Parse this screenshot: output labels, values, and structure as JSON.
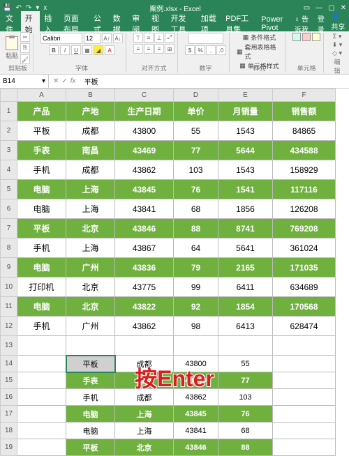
{
  "app": {
    "title": "案例.xlsx - Excel",
    "filename_tab": "x"
  },
  "menu": {
    "tabs": [
      "文件",
      "开始",
      "插入",
      "页面布局",
      "公式",
      "数据",
      "审阅",
      "视图",
      "开发工具",
      "加载项",
      "PDF工具集",
      "Power Pivot"
    ],
    "active": 1,
    "right": [
      "告诉我",
      "登录",
      "共享"
    ]
  },
  "ribbon": {
    "paste": "粘贴",
    "clipboard": "剪贴板",
    "font_name": "Calibri",
    "font_size": "12",
    "font_group": "字体",
    "align_group": "对齐方式",
    "number_group": "数字",
    "cond1": "条件格式",
    "cond2": "套用表格格式",
    "cond3": "单元格样式",
    "styles_group": "样式",
    "cells_group": "单元格",
    "edit_group": "编辑"
  },
  "namebox": "B14",
  "formula": "平板",
  "cols": [
    "A",
    "B",
    "C",
    "D",
    "E",
    "F"
  ],
  "headers": [
    "产品",
    "产地",
    "生产日期",
    "单价",
    "月销量",
    "销售额"
  ],
  "rows": [
    {
      "n": 2,
      "hl": false,
      "c": [
        "平板",
        "成都",
        "43800",
        "55",
        "1543",
        "84865"
      ]
    },
    {
      "n": 3,
      "hl": true,
      "c": [
        "手表",
        "南昌",
        "43469",
        "77",
        "5644",
        "434588"
      ]
    },
    {
      "n": 4,
      "hl": false,
      "c": [
        "手机",
        "成都",
        "43862",
        "103",
        "1543",
        "158929"
      ]
    },
    {
      "n": 5,
      "hl": true,
      "c": [
        "电脑",
        "上海",
        "43845",
        "76",
        "1541",
        "117116"
      ]
    },
    {
      "n": 6,
      "hl": false,
      "c": [
        "电脑",
        "上海",
        "43841",
        "68",
        "1856",
        "126208"
      ]
    },
    {
      "n": 7,
      "hl": true,
      "c": [
        "平板",
        "北京",
        "43846",
        "88",
        "8741",
        "769208"
      ]
    },
    {
      "n": 8,
      "hl": false,
      "c": [
        "手机",
        "上海",
        "43867",
        "64",
        "5641",
        "361024"
      ]
    },
    {
      "n": 9,
      "hl": true,
      "c": [
        "电脑",
        "广州",
        "43836",
        "79",
        "2165",
        "171035"
      ]
    },
    {
      "n": 10,
      "hl": false,
      "c": [
        "打印机",
        "北京",
        "43775",
        "99",
        "6411",
        "634689"
      ]
    },
    {
      "n": 11,
      "hl": true,
      "c": [
        "电脑",
        "北京",
        "43822",
        "92",
        "1854",
        "170568"
      ]
    },
    {
      "n": 12,
      "hl": false,
      "c": [
        "手机",
        "广州",
        "43862",
        "98",
        "6413",
        "628474"
      ]
    }
  ],
  "mini_rows": [
    {
      "n": 14,
      "hl": false,
      "active": true,
      "c": [
        "平板",
        "成都",
        "43800",
        "55"
      ]
    },
    {
      "n": 15,
      "hl": true,
      "c": [
        "手表",
        "南昌",
        "43469",
        "77"
      ]
    },
    {
      "n": 16,
      "hl": false,
      "c": [
        "手机",
        "成都",
        "43862",
        "103"
      ]
    },
    {
      "n": 17,
      "hl": true,
      "c": [
        "电脑",
        "上海",
        "43845",
        "76"
      ]
    },
    {
      "n": 18,
      "hl": false,
      "c": [
        "电脑",
        "上海",
        "43841",
        "68"
      ]
    },
    {
      "n": 19,
      "hl": true,
      "c": [
        "平板",
        "北京",
        "43846",
        "88"
      ]
    }
  ],
  "overlay_text": "按Enter",
  "colors": {
    "accent": "#2b8457",
    "highlight": "#6fb03f",
    "overlay": "#d91e1e"
  }
}
